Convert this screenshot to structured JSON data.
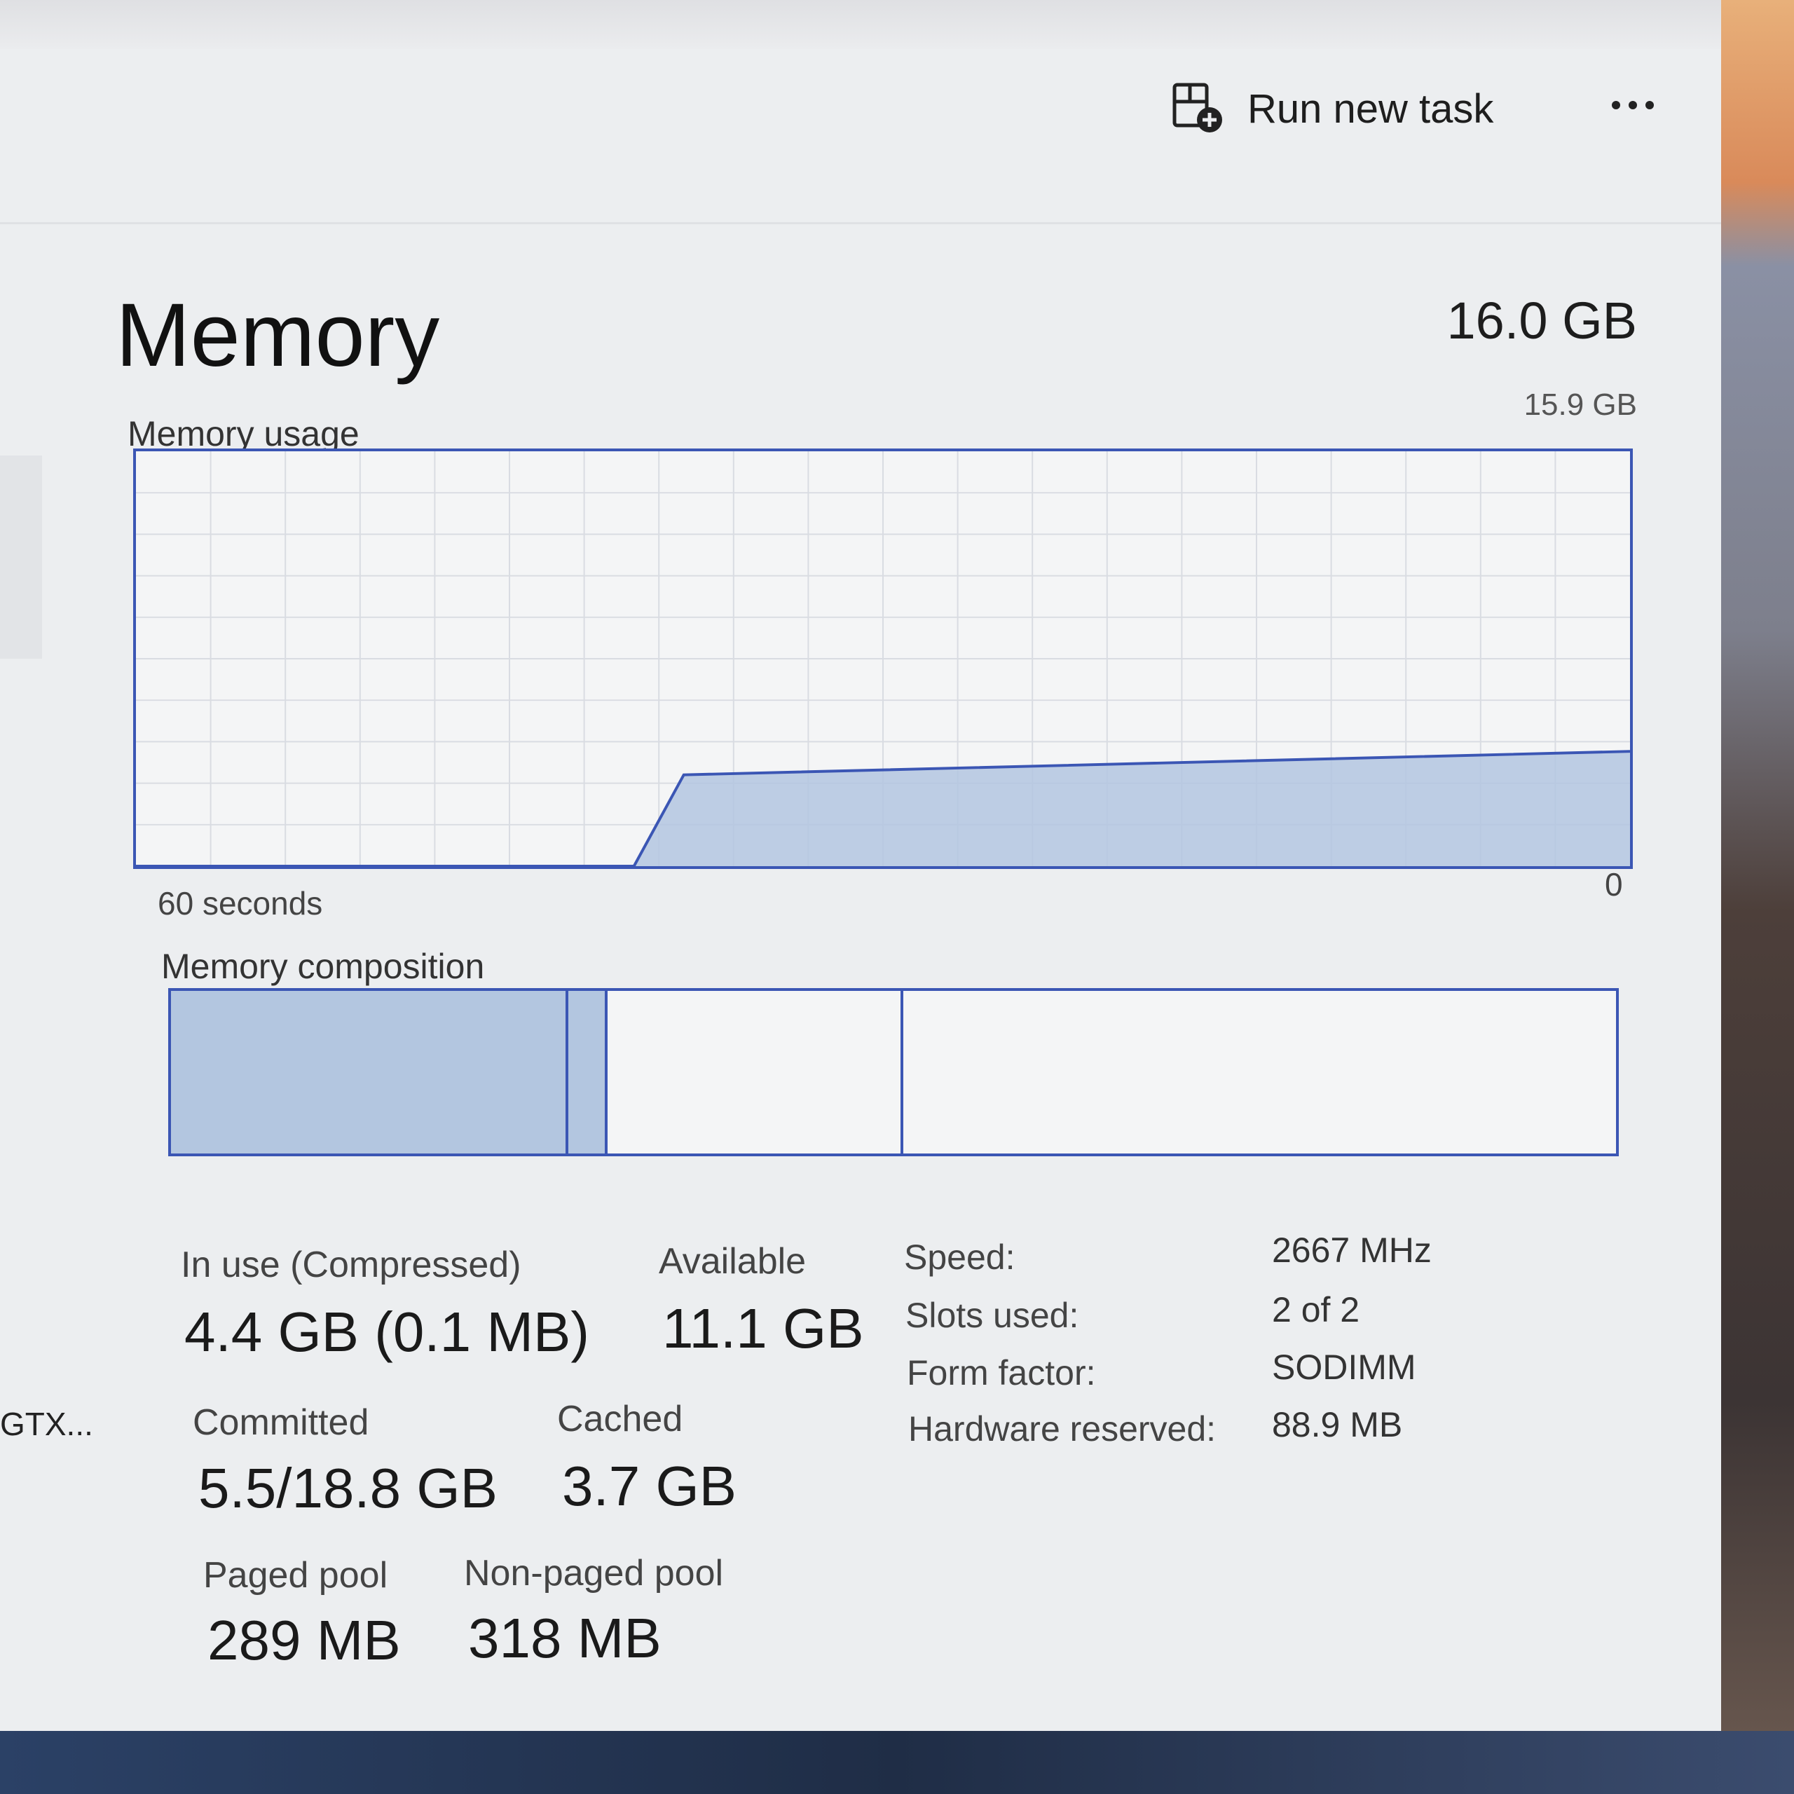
{
  "toolbar": {
    "run_new_task_label": "Run new task",
    "more_label": "More options"
  },
  "header": {
    "title": "Memory",
    "total_memory": "16.0 GB"
  },
  "usage_chart": {
    "section_label": "Memory usage",
    "max_label": "15.9 GB",
    "left_axis_label": "60 seconds",
    "right_axis_label": "0"
  },
  "composition": {
    "section_label": "Memory composition",
    "segments": [
      {
        "name": "in-use",
        "fraction": 0.275,
        "fill": "#b3c6e0"
      },
      {
        "name": "modified",
        "fraction": 0.027,
        "fill": "#b3c6e0"
      },
      {
        "name": "standby",
        "fraction": 0.205,
        "fill": "#f4f5f6"
      },
      {
        "name": "free",
        "fraction": 0.493,
        "fill": "#f4f5f6"
      }
    ]
  },
  "stats": {
    "in_use_label": "In use (Compressed)",
    "in_use_value": "4.4 GB (0.1 MB)",
    "available_label": "Available",
    "available_value": "11.1 GB",
    "committed_label": "Committed",
    "committed_value": "5.5/18.8 GB",
    "cached_label": "Cached",
    "cached_value": "3.7 GB",
    "paged_pool_label": "Paged pool",
    "paged_pool_value": "289 MB",
    "non_paged_pool_label": "Non-paged pool",
    "non_paged_pool_value": "318 MB"
  },
  "specs": {
    "speed_label": "Speed:",
    "speed_value": "2667 MHz",
    "slots_label": "Slots used:",
    "slots_value": "2 of 2",
    "form_factor_label": "Form factor:",
    "form_factor_value": "SODIMM",
    "hw_reserved_label": "Hardware reserved:",
    "hw_reserved_value": "88.9 MB"
  },
  "sidebar": {
    "gpu_label": "GTX..."
  },
  "chart_data": {
    "type": "area",
    "title": "Memory usage",
    "xlabel": "",
    "ylabel": "",
    "x_range_labels": [
      "60 seconds",
      "0"
    ],
    "ylim": [
      0,
      15.9
    ],
    "x": [
      60,
      40,
      38,
      0
    ],
    "series": [
      {
        "values": [
          0,
          0,
          3.5,
          4.4
        ]
      }
    ],
    "grid": true,
    "colors": {
      "fill": "#b3c6e0",
      "line": "#3b56b4"
    }
  }
}
